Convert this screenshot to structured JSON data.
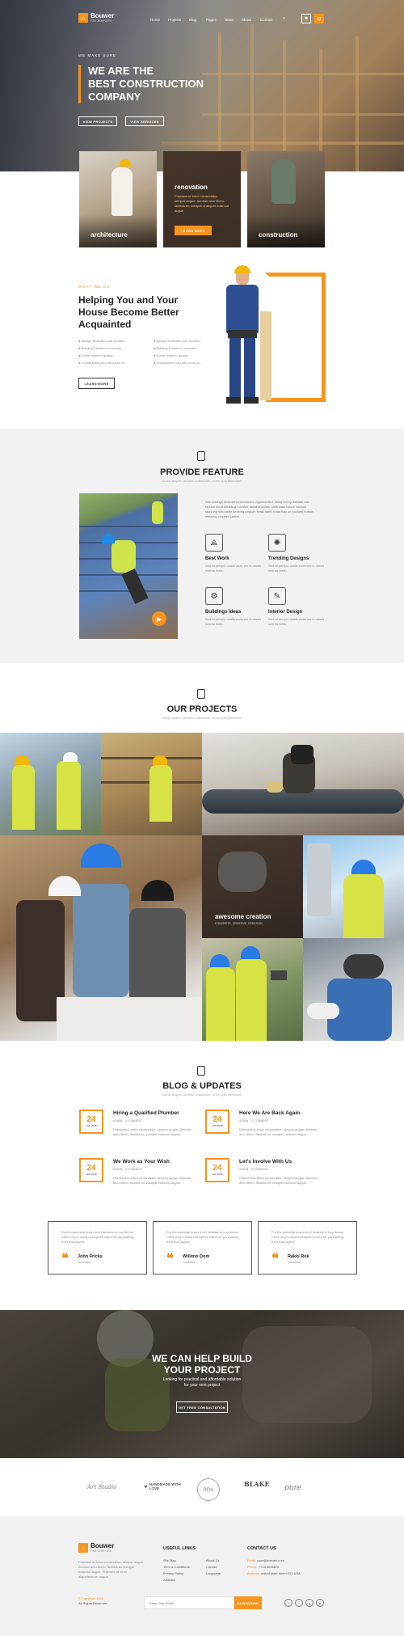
{
  "brand": {
    "name": "Bouwer",
    "tagline": "PSD TEMPLATE",
    "accent": "#f7941d"
  },
  "nav": {
    "items": [
      "Home",
      "Projects",
      "Blog",
      "Pages",
      "News",
      "About",
      "Contact"
    ]
  },
  "hero": {
    "kicker": "WE MAKE SURE",
    "title_1": "WE ARE THE",
    "title_2": "BEST CONSTRUCTION",
    "title_3": "COMPANY",
    "btn_1": "VIEW PROJECTS",
    "btn_2": "VIEW SERVICES"
  },
  "services": {
    "card_1": "architecture",
    "card_2_title": "renovation",
    "card_2_text": "Praesent ut tortor consectetur, semper augue. Aenean arcu libero, facilisis eu volutpat ut aliquet euismod augue.",
    "card_2_btn": "LEARN MORE",
    "card_3": "construction"
  },
  "about": {
    "kicker": "WHAT WE DO",
    "title_1": "Helping You and Your",
    "title_2": "House Become Better",
    "title_3": "Acquainted",
    "list_left": [
      "Always dedicated and devoted",
      "Building it better in concrete",
      "Come home to quality",
      "Construction you can count on"
    ],
    "list_right": [
      "Always dedicated and devoted",
      "Building it better in concrete",
      "Come home to quality",
      "Construction you can count on"
    ],
    "btn": "LEARN MORE"
  },
  "feature": {
    "title": "PROVIDE FEATURE",
    "subtitle": "auctor aliquet. Aenean sollicitudin, lorem quis bibendum",
    "intro": "See-through delicate embroidered organza blue lining luxury acetate-mix stretch pleat detailing. Leather detail shoulder contrastic colour contour stunning silhouette working peplum small lapel collar flap on pockets button stitching cropped jacket.",
    "items": [
      {
        "icon": "compass-icon",
        "title": "Best Work",
        "text": "Sed ut perspic iciatis unde om is omnis iuntnta licetu."
      },
      {
        "icon": "lightbulb-icon",
        "title": "Trending Designs",
        "text": "Sed ut perspic iciatis unde om is omnis iuntnta licetu."
      },
      {
        "icon": "cogs-icon",
        "title": "Buildings Ideas",
        "text": "Sed ut perspic iciatis unde om is omnis iuntnta licetu."
      },
      {
        "icon": "ruler-pencil-icon",
        "title": "Interior Design",
        "text": "Sed ut perspic iciatis unde om is omnis iuntnta licetu."
      }
    ]
  },
  "projects": {
    "title": "OUR PROJECTS",
    "subtitle": "auctor aliquet. Aenean sollicitudin, lorem quis bibendum",
    "overlay_title": "awesome creation",
    "overlay_sub": "CONCRETE, CREATIVE, CREATION"
  },
  "blog": {
    "title": "BLOG & UPDATES",
    "subtitle": "auctor aliquet. Aenean sollicitudin, lorem quis bibendum",
    "posts": [
      {
        "day": "24",
        "month": "JAN 2018",
        "title": "Hiring a Qualified Plumber",
        "author": "ADMIN",
        "comments": "0 COMMENT",
        "text": "Praesent ut tortor consectetur, semper augue. Aenean arcu libero, facilisis eu volutpat euismod augue."
      },
      {
        "day": "24",
        "month": "JAN 2018",
        "title": "Here We Are Back Again",
        "author": "ADMIN",
        "comments": "0 COMMENT",
        "text": "Praesent ut tortor consectetur, semper augue. Aenean arcu libero, facilisis eu volutpat euismod augue."
      },
      {
        "day": "24",
        "month": "JAN 2018",
        "title": "We Work as Your Wish",
        "author": "ADMIN",
        "comments": "0 COMMENT",
        "text": "Praesent ut tortor consectetur, semper augue. Aenean arcu libero, facilisis eu volutpat euismod augue."
      },
      {
        "day": "24",
        "month": "JAN 2018",
        "title": "Let's Involve With Us",
        "author": "ADMIN",
        "comments": "0 COMMENT",
        "text": "Praesent ut tortor consectetur, semper augue. Aenean arcu libero, facilisis eu volutpat euismod augue."
      }
    ]
  },
  "testimonials": [
    {
      "text": "For the potential buyer don't hesitate to buy theme, Chris very Lumina uninspired editor for purchasing from their agent.",
      "name": "John Fricks",
      "role": "Contractor"
    },
    {
      "text": "For the potential buyer don't hesitate to buy theme, Chris very Lumina uninspired editor for purchasing from their agent.",
      "name": "Willimo Dom",
      "role": "Contractor"
    },
    {
      "text": "For the potential buyer don't hesitate to buy theme, Chris very Lumina uninspired editor for purchasing from their agent.",
      "name": "Rakki Rok",
      "role": "Contractor"
    }
  ],
  "cta": {
    "title_1": "WE CAN HELP BUILD",
    "title_2": "YOUR PROJECT",
    "text_1": "Looking for practical and affordable solution",
    "text_2": "for your next project",
    "btn": "GET FREE CONSULTATION"
  },
  "partners": [
    "Art Studio",
    "HANDMADE WITH LOVE",
    "Mrs",
    "BLAKE",
    "pure"
  ],
  "footer": {
    "about": "Praesent ut tortor consectetur, semper augue. Aenean arcu libero, facilisis eu volutpat euismod augue. Praesent ut tortor aliquetsuscon augue.",
    "copy_1": "© Copyright 2018",
    "copy_2": "All Rights Reserved.",
    "links_title": "USEFUL LINKS",
    "links_col1": [
      "Site Map",
      "Term & Conditions",
      "Privacy Policy",
      "Affiliates"
    ],
    "links_col2": [
      "About Us",
      "Contact",
      "Language"
    ],
    "contact_title": "CONTACT US",
    "email_label": "Email:",
    "email": "user@domain.com",
    "phone_label": "Phone:",
    "phone": "+714 0246676",
    "address_label": "Address:",
    "address": "united state street 221 USA",
    "newsletter_placeholder": "Enter Your Email...",
    "subscribe": "SUBSCRIBE"
  }
}
